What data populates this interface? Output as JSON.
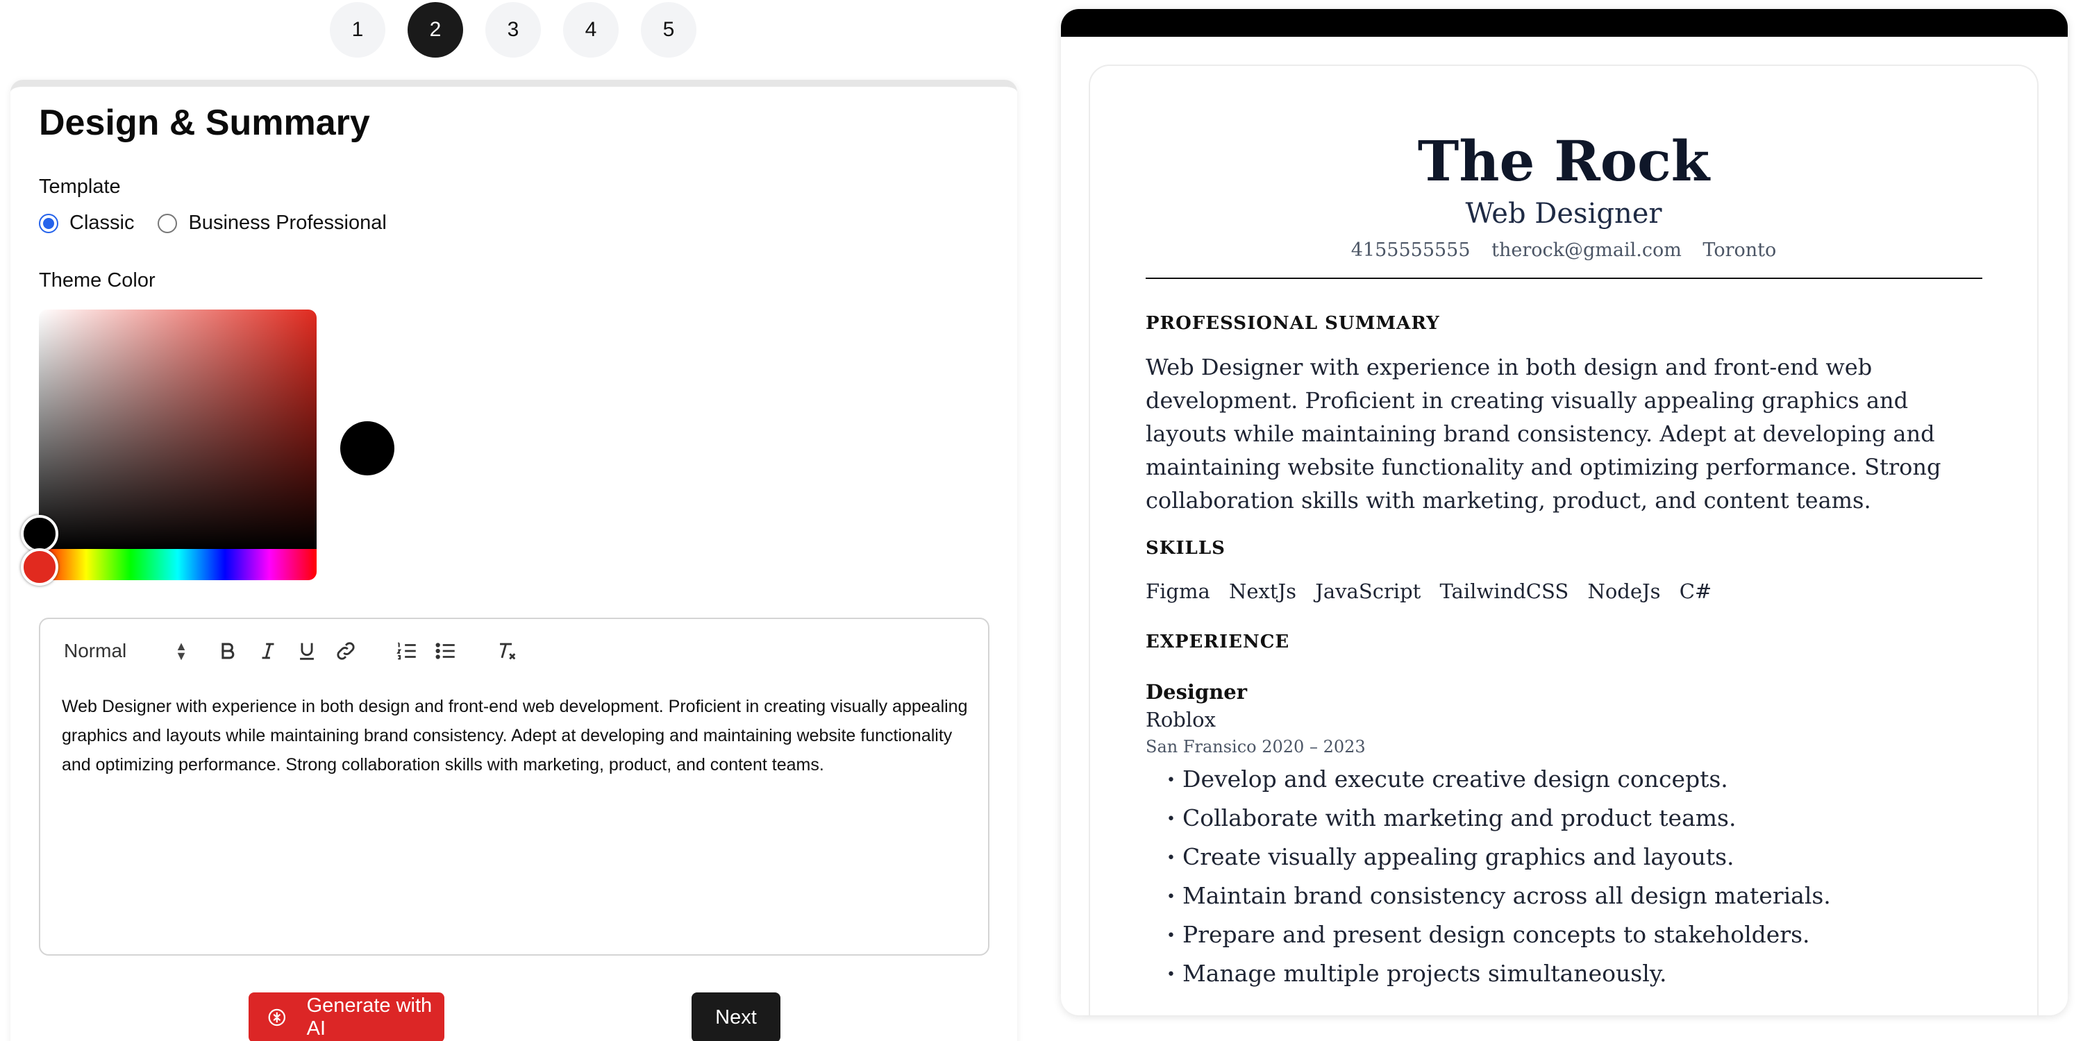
{
  "steps": [
    "1",
    "2",
    "3",
    "4",
    "5"
  ],
  "active_step": "2",
  "editor": {
    "title": "Design & Summary",
    "template_label": "Template",
    "template_options": [
      "Classic",
      "Business Professional"
    ],
    "template_selected": "Classic",
    "theme_color_label": "Theme Color",
    "theme_color_value": "#000000",
    "hue_color": "#e12a1f",
    "format_select": "Normal",
    "summary_text": "Web Designer with experience in both design and front-end web development. Proficient in creating visually appealing graphics and layouts while maintaining brand consistency. Adept at developing and maintaining website functionality and optimizing performance. Strong collaboration skills with marketing, product, and content teams.",
    "toolbar_icons": [
      "bold-icon",
      "italic-icon",
      "underline-icon",
      "link-icon",
      "ordered-list-icon",
      "bullet-list-icon",
      "clear-format-icon"
    ],
    "ai_button": "Generate with AI",
    "next_button": "Next"
  },
  "resume": {
    "name": "The Rock",
    "title": "Web Designer",
    "phone": "4155555555",
    "email": "therock@gmail.com",
    "location": "Toronto",
    "summary_heading": "PROFESSIONAL SUMMARY",
    "summary": "Web Designer with experience in both design and front-end web development. Proficient in creating visually appealing graphics and layouts while maintaining brand consistency. Adept at developing and maintaining website functionality and optimizing performance. Strong collaboration skills with marketing, product, and content teams.",
    "skills_heading": "SKILLS",
    "skills": [
      "Figma",
      "NextJs",
      "JavaScript",
      "TailwindCSS",
      "NodeJs",
      "C#"
    ],
    "experience_heading": "EXPERIENCE",
    "experience": {
      "role": "Designer",
      "company": "Roblox",
      "meta": "San Fransico 2020 – 2023",
      "bullets": [
        "Develop and execute creative design concepts.",
        "Collaborate with marketing and product teams.",
        "Create visually appealing graphics and layouts.",
        "Maintain brand consistency across all design materials.",
        "Prepare and present design concepts to stakeholders.",
        "Manage multiple projects simultaneously."
      ]
    }
  }
}
